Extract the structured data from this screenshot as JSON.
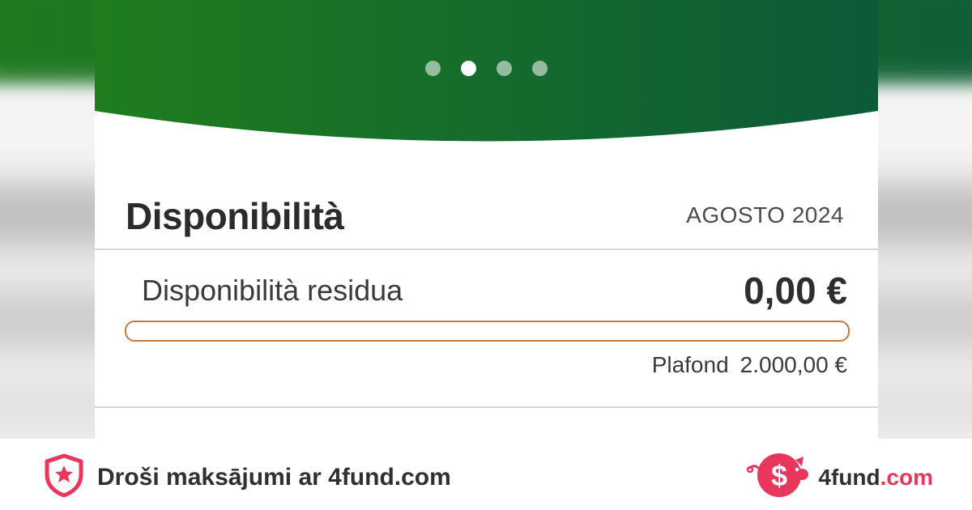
{
  "carousel": {
    "count": 4,
    "active_index": 1
  },
  "availability": {
    "title": "Disponibilità",
    "period": "AGOSTO 2024",
    "residual_label": "Disponibilità residua",
    "residual_amount": "0,00 €",
    "usage_fraction": 0,
    "plafond_label": "Plafond",
    "plafond_amount": "2.000,00 €"
  },
  "footer": {
    "secure_text": "Droši maksājumi ar 4fund.com",
    "brand_name": "4fund",
    "brand_tld": ".com"
  },
  "colors": {
    "hero_left": "#1f7d1f",
    "hero_right": "#0b5a38",
    "progress": "#c8783a",
    "brand_accent": "#e8365d"
  },
  "icons": {
    "secure": "shield-star-icon",
    "brand": "piggy-bank-dollar-icon"
  }
}
